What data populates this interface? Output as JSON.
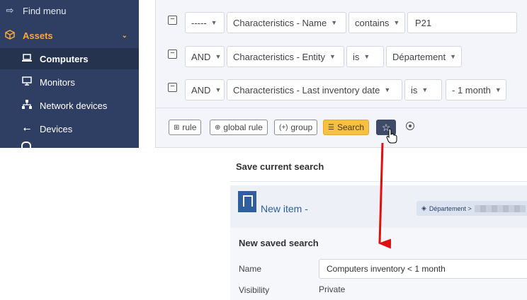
{
  "sidebar": {
    "find_menu": "Find menu",
    "assets": "Assets",
    "items": [
      {
        "label": "Computers",
        "active": true,
        "icon": "laptop-icon"
      },
      {
        "label": "Monitors",
        "icon": "monitor-icon"
      },
      {
        "label": "Network devices",
        "icon": "network-icon"
      },
      {
        "label": "Devices",
        "icon": "usb-icon"
      }
    ]
  },
  "search": {
    "rows": [
      {
        "link": "-----",
        "field": "Characteristics - Name",
        "operator": "contains",
        "value": "P21"
      },
      {
        "link": "AND",
        "field": "Characteristics - Entity",
        "operator": "is",
        "value": "Département"
      },
      {
        "link": "AND",
        "field": "Characteristics - Last inventory date",
        "operator": "is",
        "value": "- 1 month"
      }
    ],
    "buttons": {
      "rule": "rule",
      "global_rule": "global rule",
      "group": "group",
      "search": "Search"
    }
  },
  "dialog": {
    "title": "Save current search",
    "item_header": "New item -",
    "entity_badge": "Département >",
    "form_title": "New saved search",
    "name_label": "Name",
    "name_value": "Computers inventory < 1 month",
    "visibility_label": "Visibility",
    "visibility_value": "Private"
  },
  "colors": {
    "sidebar_bg": "#2f3f64",
    "accent": "#f6a83b",
    "search_button": "#f6c042",
    "star_button": "#3d4b68",
    "arrow": "#e01010",
    "link": "#2f5f9e"
  }
}
